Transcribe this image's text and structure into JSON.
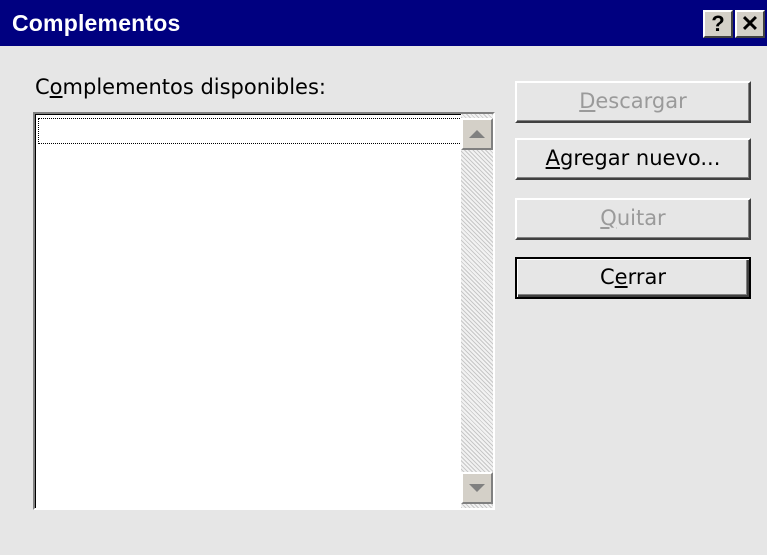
{
  "window": {
    "title": "Complementos",
    "help_label": "?",
    "close_label": "✕"
  },
  "list": {
    "label_pre": "C",
    "label_accel": "o",
    "label_post": "mplementos disponibles:",
    "items": []
  },
  "buttons": {
    "download": {
      "accel": "D",
      "rest": "escargar",
      "enabled": false
    },
    "add_new": {
      "accel": "A",
      "rest": "gregar nuevo...",
      "enabled": true
    },
    "remove": {
      "accel": "Q",
      "rest": "uitar",
      "enabled": false
    },
    "close": {
      "pre": "C",
      "accel": "e",
      "rest": "rrar",
      "enabled": true,
      "default": true
    }
  },
  "icons": {
    "scroll_up": "arrow-up-icon",
    "scroll_down": "arrow-down-icon"
  },
  "colors": {
    "titlebar": "#000080",
    "face": "#e6e6e6",
    "disabled_text": "#9a9a9a"
  }
}
